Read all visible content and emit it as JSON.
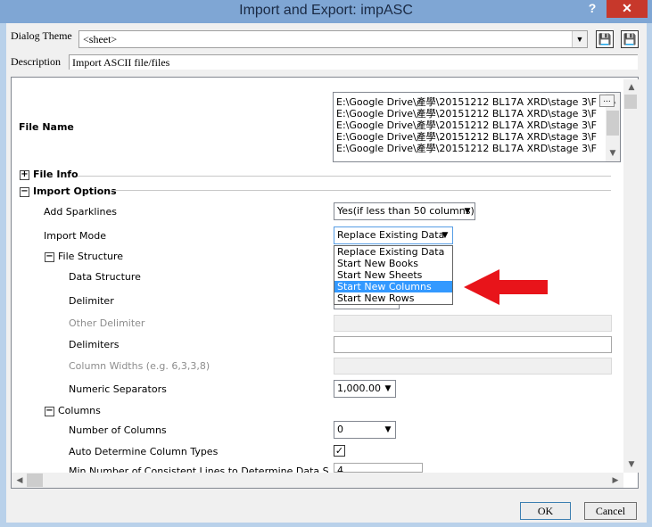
{
  "window": {
    "title": "Import and Export: impASC",
    "help": "?",
    "close": "✕"
  },
  "dialog_theme": {
    "label": "Dialog Theme",
    "value": "<sheet>",
    "save_icon": "💾",
    "save_as_icon": "💾"
  },
  "description": {
    "label": "Description",
    "value": "Import ASCII file/files"
  },
  "file_name": {
    "label": "File Name",
    "files": [
      "E:\\Google Drive\\產學\\20151212 BL17A XRD\\stage 3\\F",
      "E:\\Google Drive\\產學\\20151212 BL17A XRD\\stage 3\\F",
      "E:\\Google Drive\\產學\\20151212 BL17A XRD\\stage 3\\F",
      "E:\\Google Drive\\產學\\20151212 BL17A XRD\\stage 3\\F",
      "E:\\Google Drive\\產學\\20151212 BL17A XRD\\stage 3\\F"
    ],
    "browse": "..."
  },
  "tree": {
    "file_info": "File Info",
    "import_options": "Import Options",
    "add_sparklines": {
      "label": "Add Sparklines",
      "value": "Yes(if less than 50 columns)"
    },
    "import_mode": {
      "label": "Import Mode",
      "value": "Replace Existing Data",
      "options": [
        "Replace Existing Data",
        "Start New Books",
        "Start New Sheets",
        "Start New Columns",
        "Start New Rows"
      ],
      "highlighted": "Start New Columns"
    },
    "file_structure": "File Structure",
    "data_structure": "Data Structure",
    "delimiter": "Delimiter",
    "other_delimiter": "Other Delimiter",
    "delimiters": {
      "label": "Delimiters",
      "value": ""
    },
    "column_widths": "Column Widths (e.g. 6,3,3,8)",
    "numeric_separators": {
      "label": "Numeric Separators",
      "value": "1,000.00"
    },
    "columns": "Columns",
    "number_of_columns": {
      "label": "Number of Columns",
      "value": "0"
    },
    "auto_determine": {
      "label": "Auto Determine Column Types",
      "checked": true,
      "check_mark": "✓"
    },
    "min_lines": {
      "label": "Min Number of Consistent Lines to Determine Data Structure",
      "value": "4"
    }
  },
  "buttons": {
    "ok": "OK",
    "cancel": "Cancel"
  },
  "colors": {
    "accent_arrow": "#e8141a",
    "selection": "#3399ff",
    "titlebar": "#7fa6d4",
    "close": "#c7382b"
  }
}
